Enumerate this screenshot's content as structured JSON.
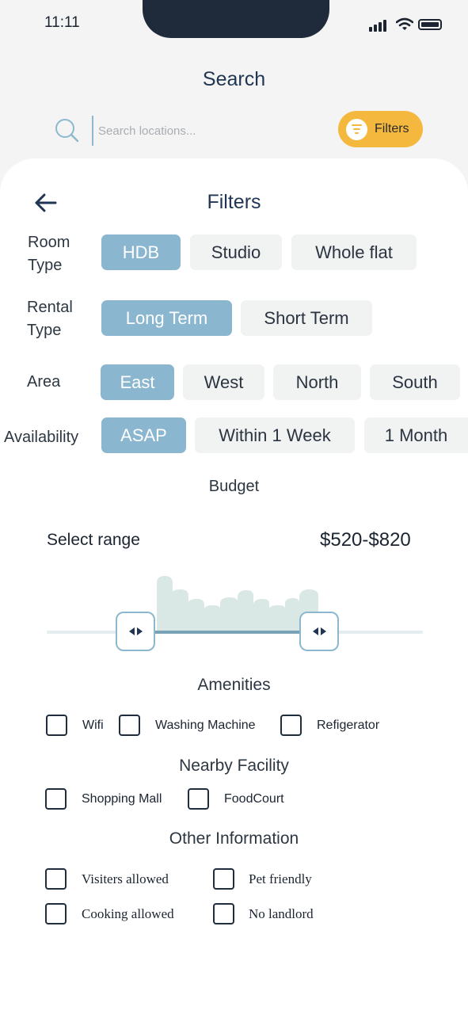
{
  "status_bar": {
    "time": "11:11"
  },
  "search": {
    "title": "Search",
    "placeholder": "Search locations...",
    "filters_button": "Filters"
  },
  "filters": {
    "title": "Filters",
    "room_type": {
      "label_line1": "Room",
      "label_line2": "Type",
      "options": [
        "HDB",
        "Studio",
        "Whole flat"
      ],
      "selected": "HDB"
    },
    "rental_type": {
      "label_line1": "Rental",
      "label_line2": "Type",
      "options": [
        "Long Term",
        "Short Term"
      ],
      "selected": "Long Term"
    },
    "area": {
      "label": "Area",
      "options": [
        "East",
        "West",
        "North",
        "South"
      ],
      "selected": "East"
    },
    "availability": {
      "label": "Availability",
      "options": [
        "ASAP",
        "Within 1 Week",
        "1 Month"
      ],
      "selected": "ASAP"
    }
  },
  "budget": {
    "title": "Budget",
    "range_label": "Select range",
    "range_value": "$520-$820"
  },
  "amenities": {
    "title": "Amenities",
    "items": [
      "Wifi",
      "Washing Machine",
      "Refigerator"
    ]
  },
  "nearby": {
    "title": "Nearby Facility",
    "items": [
      "Shopping Mall",
      "FoodCourt"
    ]
  },
  "other": {
    "title": "Other Information",
    "items": [
      "Visiters allowed",
      "Pet friendly",
      "Cooking allowed",
      "No landlord"
    ]
  },
  "colors": {
    "accent_yellow": "#f4b83e",
    "selected_chip": "#8ab6cf",
    "title_navy": "#1f3552",
    "histogram": "#d9e7e5"
  },
  "icons": {
    "search": "search-icon",
    "filter": "filter-icon",
    "back": "arrow-left-icon",
    "handle": "left-right-arrows-icon"
  }
}
